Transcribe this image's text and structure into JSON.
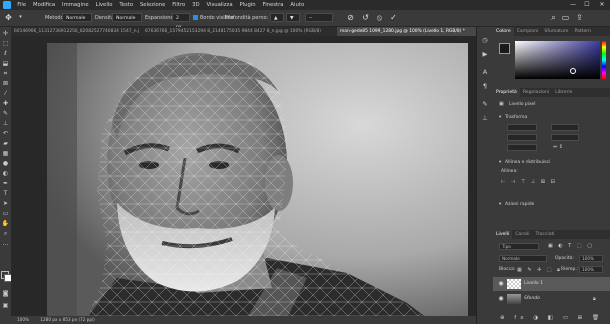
{
  "menubar": {
    "items": [
      "File",
      "Modifica",
      "Immagine",
      "Livello",
      "Testo",
      "Selezione",
      "Filtro",
      "3D",
      "Visualizza",
      "Plugin",
      "Finestra",
      "Aiuto"
    ]
  },
  "window_controls": [
    "—",
    "☐",
    "✕"
  ],
  "options_bar": {
    "metodo_label": "Metodo:",
    "metodo_value": "Normale",
    "densita_label": "Densità:",
    "densita_value": "Normale",
    "espansione_label": "Espansione:",
    "espansione_value": "2 px",
    "bordo_label": "Bordo visibile",
    "profondita_label": "Profondità perno:",
    "profondita_value": "--"
  },
  "tabs": [
    {
      "label": "60146906_11312736912256_82082527740834 1547_n.jpg @ 100% (RGB/8)",
      "active": false
    },
    {
      "label": "67636766_1579452153294 8_2148175035 9844 8427 8_n.jpg @ 100% (RGB/8)",
      "active": false
    },
    {
      "label": "man-gede85 1099_1280.jpg @ 100% (Livello 1, RGB/8) *",
      "active": true
    }
  ],
  "status": {
    "zoom": "100%",
    "doc": "1280 px x 853 px (72 ppi)"
  },
  "color_panel": {
    "tabs": [
      "Colore",
      "Campioni",
      "Sfumature",
      "Pattern"
    ],
    "active": "Colore",
    "foreground": "#1a1a1a",
    "background": "#ffffff",
    "hue_color": "#3d3a9f"
  },
  "properties_panel": {
    "tabs": [
      "Proprietà",
      "Regolazioni",
      "Librerie"
    ],
    "active": "Proprietà",
    "layer_type": "Livello pixel",
    "trasforma_label": "Trasforma",
    "allinea_label": "Allinea e distribuisci",
    "allinea_sub": "Allinea:",
    "azioni_label": "Azioni rapide"
  },
  "layers_panel": {
    "tabs": [
      "Livelli",
      "Canali",
      "Tracciati"
    ],
    "active": "Livelli",
    "filter": "Tipo",
    "blend_mode": "Normale",
    "opacity_label": "Opacità:",
    "opacity_value": "100%",
    "lock_label": "Blocca:",
    "fill_label": "Riemp.:",
    "fill_value": "100%",
    "layers": [
      {
        "name": "Livello 1",
        "selected": true
      },
      {
        "name": "Sfondo",
        "selected": false
      }
    ]
  }
}
